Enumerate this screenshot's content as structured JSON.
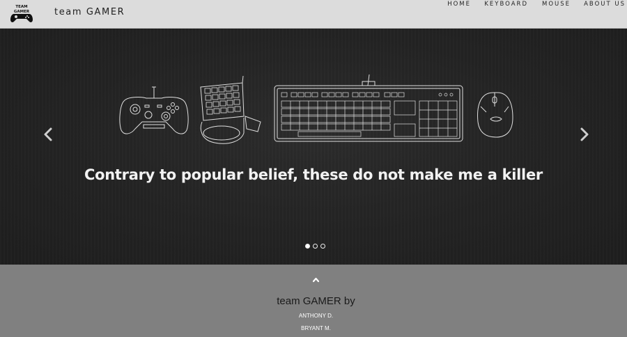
{
  "navbar": {
    "brand": "team GAMER",
    "logo_text_top": "TEAM",
    "logo_text_bottom": "GAMER",
    "links": [
      "HOME",
      "KEYBOARD",
      "MOUSE",
      "ABOUT US"
    ]
  },
  "carousel": {
    "caption": "Contrary to popular belief, these do not make me a killer",
    "slide_count": 3,
    "active_slide": 1,
    "prev_icon": "chevron-left-icon",
    "next_icon": "chevron-right-icon"
  },
  "footer": {
    "up_icon": "chevron-up-icon",
    "title": "team GAMER by",
    "authors": [
      "ANTHONY D.",
      "BRYANT M."
    ]
  },
  "colors": {
    "navbar_bg": "#dcdcdc",
    "carousel_bg": "#252525",
    "footer_bg": "#808080",
    "caption": "#f2f2f2"
  }
}
